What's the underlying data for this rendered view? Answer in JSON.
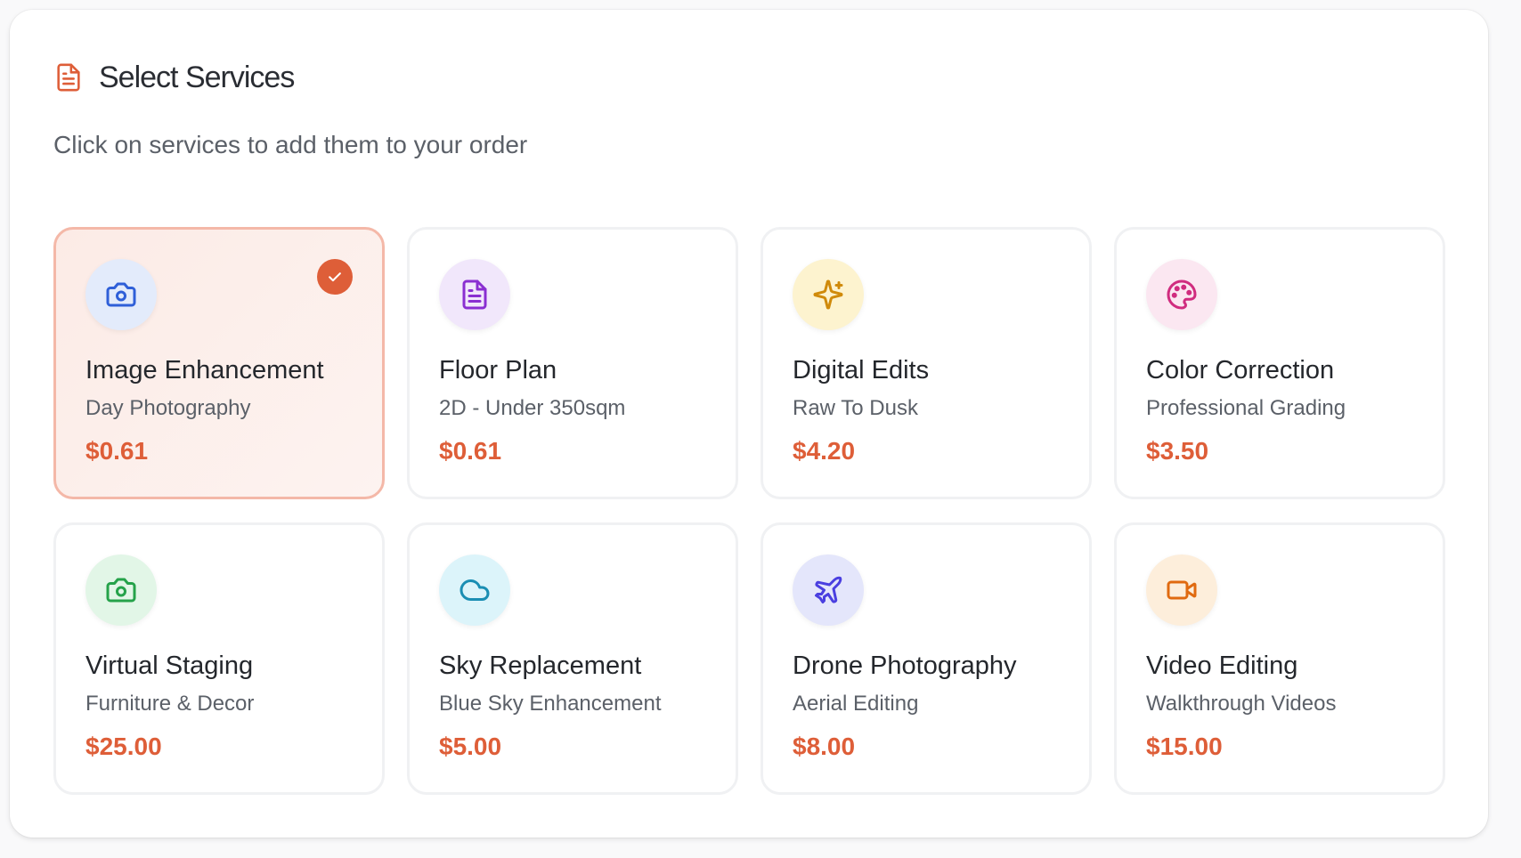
{
  "header": {
    "title": "Select Services",
    "subtitle": "Click on services to add them to your order"
  },
  "colors": {
    "accent": "#de5e38",
    "selected_border": "#f4b8a8"
  },
  "services": [
    {
      "title": "Image Enhancement",
      "subtitle": "Day Photography",
      "price": "$0.61",
      "icon": "camera-icon",
      "icon_bg": "#e3ebfb",
      "icon_color": "#2f5fd8",
      "selected": true
    },
    {
      "title": "Floor Plan",
      "subtitle": "2D - Under 350sqm",
      "price": "$0.61",
      "icon": "document-icon",
      "icon_bg": "#f1e7fb",
      "icon_color": "#8a2fd1",
      "selected": false
    },
    {
      "title": "Digital Edits",
      "subtitle": "Raw To Dusk",
      "price": "$4.20",
      "icon": "sparkles-icon",
      "icon_bg": "#fdf3cf",
      "icon_color": "#d08a0a",
      "selected": false
    },
    {
      "title": "Color Correction",
      "subtitle": "Professional Grading",
      "price": "$3.50",
      "icon": "palette-icon",
      "icon_bg": "#fbe7f1",
      "icon_color": "#d02c7f",
      "selected": false
    },
    {
      "title": "Virtual Staging",
      "subtitle": "Furniture & Decor",
      "price": "$25.00",
      "icon": "camera-icon",
      "icon_bg": "#e2f6e7",
      "icon_color": "#25a24a",
      "selected": false
    },
    {
      "title": "Sky Replacement",
      "subtitle": "Blue Sky Enhancement",
      "price": "$5.00",
      "icon": "cloud-icon",
      "icon_bg": "#dcf4fa",
      "icon_color": "#1a8eb3",
      "selected": false
    },
    {
      "title": "Drone Photography",
      "subtitle": "Aerial Editing",
      "price": "$8.00",
      "icon": "plane-icon",
      "icon_bg": "#e4e6fb",
      "icon_color": "#4a3fe0",
      "selected": false
    },
    {
      "title": "Video Editing",
      "subtitle": "Walkthrough Videos",
      "price": "$15.00",
      "icon": "video-icon",
      "icon_bg": "#fdeedb",
      "icon_color": "#e06a10",
      "selected": false
    }
  ]
}
